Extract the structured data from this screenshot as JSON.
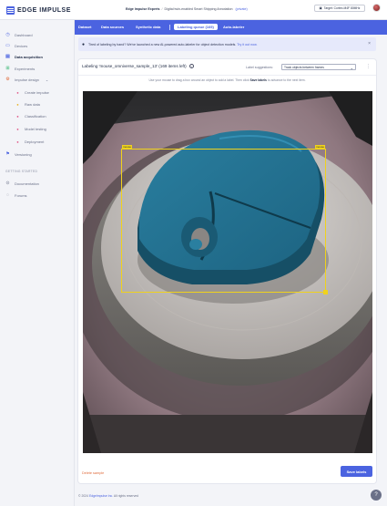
{
  "header": {
    "logo_text": "EDGE IMPULSE",
    "project_owner": "Edge Impulse Experts",
    "project_name": "Digital twin-enabled Smart Shipping Annotation",
    "project_tag": "(private)",
    "target_label": "Target: Cortex-M4F 80MHz"
  },
  "sidebar": {
    "items": [
      {
        "label": "Dashboard",
        "icon": "dashboard-icon"
      },
      {
        "label": "Devices",
        "icon": "devices-icon"
      },
      {
        "label": "Data acquisition",
        "icon": "data-acquisition-icon"
      },
      {
        "label": "Experiments",
        "icon": "experiments-icon"
      },
      {
        "label": "Impulse design",
        "icon": "impulse-design-icon"
      }
    ],
    "sub_items": [
      {
        "label": "Create impulse"
      },
      {
        "label": "Raw data"
      },
      {
        "label": "Classification"
      },
      {
        "label": "Model testing"
      },
      {
        "label": "Deployment"
      }
    ],
    "versioning": "Versioning",
    "section_getting_started": "GETTING STARTED",
    "documentation": "Documentation",
    "forums": "Forums"
  },
  "tabs": {
    "dataset": "Dataset",
    "data_sources": "Data sources",
    "synthetic_data": "Synthetic data",
    "labeling_queue": "Labeling queue (169)",
    "auto_labeler": "Auto-labeler"
  },
  "banner": {
    "text": "Tired of labeling by hand? We've launched a new AI-powered auto-labeler for object detection models.",
    "link": "Try it out now."
  },
  "card": {
    "title": "Labeling 'mouse_omniverse_sample_13' (169 items left)",
    "suggestions_label": "Label suggestions:",
    "suggestions_value": "Track objects between frames",
    "instructions_pre": "Use your mouse to drag a box around an object to add a label. Then click",
    "instructions_bold": "Save labels",
    "instructions_post": "to advance to the next item.",
    "bbox_label": "mouse",
    "bbox_label_right": "mouse",
    "delete_label": "Delete sample",
    "save_label": "Save labels"
  },
  "footer": {
    "text": "© 2024",
    "link": "EdgeImpulse Inc.",
    "rights": "All rights reserved"
  },
  "colors": {
    "accent": "#4b63e0",
    "bbox": "#f0d21c",
    "object": "#1f6e8c"
  }
}
